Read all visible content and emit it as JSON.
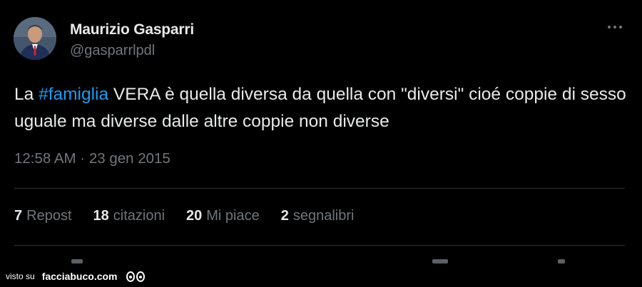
{
  "tweet": {
    "author_name": "Maurizio Gasparri",
    "author_handle": "@gasparrlpdl",
    "text_before": "La ",
    "hashtag": "#famiglia",
    "text_after": " VERA è quella diversa da quella con \"diversi\" cioé coppie di sesso uguale ma diverse dalle altre coppie non diverse",
    "timestamp": "12:58 AM · 23 gen 2015",
    "stats": [
      {
        "num": "7",
        "label": "Repost"
      },
      {
        "num": "18",
        "label": "citazioni"
      },
      {
        "num": "20",
        "label": "Mi piace"
      },
      {
        "num": "2",
        "label": "segnalibri"
      }
    ]
  },
  "watermark": {
    "visto": "visto su",
    "site": "facciabuco.com"
  },
  "colors": {
    "background": "#000000",
    "text": "#e7e9ea",
    "muted": "#71767b",
    "hashtag": "#1d9bf0",
    "divider": "#2f3336"
  },
  "icons": {
    "more": "more-horizontal-icon",
    "watermark_eyes": "eyes-icon"
  }
}
